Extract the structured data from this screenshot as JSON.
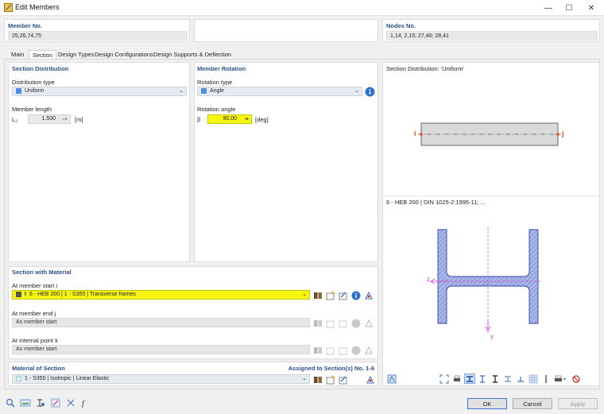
{
  "window": {
    "title": "Edit Members"
  },
  "member_no": {
    "label": "Member No.",
    "value": "25,26,74,75"
  },
  "nodes_no": {
    "label": "Nodes No.",
    "value": "1,14; 2,15; 27,40; 28,41"
  },
  "tabs": [
    {
      "label": "Main"
    },
    {
      "label": "Section"
    },
    {
      "label": "Design Types"
    },
    {
      "label": "Design Configurations"
    },
    {
      "label": "Design Supports & Deflection"
    }
  ],
  "section_distribution": {
    "header": "Section Distribution",
    "type_label": "Distribution type",
    "type_value": "Uniform",
    "type_color": "#4a90e2",
    "length_label": "Member length",
    "length_symbol": "L₂",
    "length_value": "1.500",
    "length_unit": "[m]"
  },
  "member_rotation": {
    "header": "Member Rotation",
    "type_label": "Rotation type",
    "type_value": "Angle",
    "angle_label": "Rotation angle",
    "angle_symbol": "β",
    "angle_value": "90.00",
    "angle_unit": "[deg]"
  },
  "preview": {
    "distribution_title": "Section Distribution: 'Uniform'",
    "node_i": "i",
    "node_j": "j",
    "section_title": "6 - HEB 200 | DIN 1025-2:1995-11; ...",
    "axis_z": "z",
    "axis_y": "y"
  },
  "section_with_material": {
    "header": "Section with Material",
    "start_label": "At member start i",
    "start_value": "6 - HEB 200 | 1 - S355 | Transverse frames",
    "end_label": "At member end j",
    "end_value": "As member start",
    "internal_label": "At internal point k",
    "internal_value": "As member start"
  },
  "material": {
    "header": "Material of Section",
    "assigned": "Assigned to Section(s) No. 1-6",
    "value": "1 - S355 | Isotropic | Linear Elastic"
  },
  "buttons": {
    "ok": "OK",
    "cancel": "Cancel",
    "apply": "Apply"
  },
  "colors": {
    "accent": "#2b4f8f",
    "highlight": "#f5f50f",
    "section_fill": "#a9b7e8",
    "node": "#e8521a"
  }
}
